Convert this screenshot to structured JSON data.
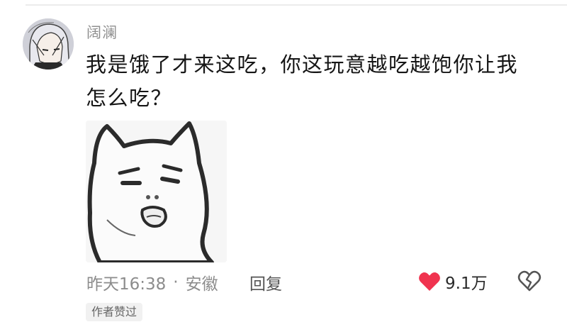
{
  "comment": {
    "username": "阔澜",
    "text": "我是饿了才来这吃，你这玩意越吃越饱你让我怎么吃？",
    "time": "昨天16:38",
    "separator": "·",
    "location": "安徽",
    "reply_label": "回复",
    "like_count": "9.1万",
    "author_liked_badge": "作者赞过",
    "sticker_icon": "cartoon-cat-sticker",
    "avatar_icon": "anime-avatar"
  },
  "colors": {
    "like_heart": "#f0334f",
    "meta_text": "#8c8c8c",
    "username": "#8f8f8f"
  }
}
